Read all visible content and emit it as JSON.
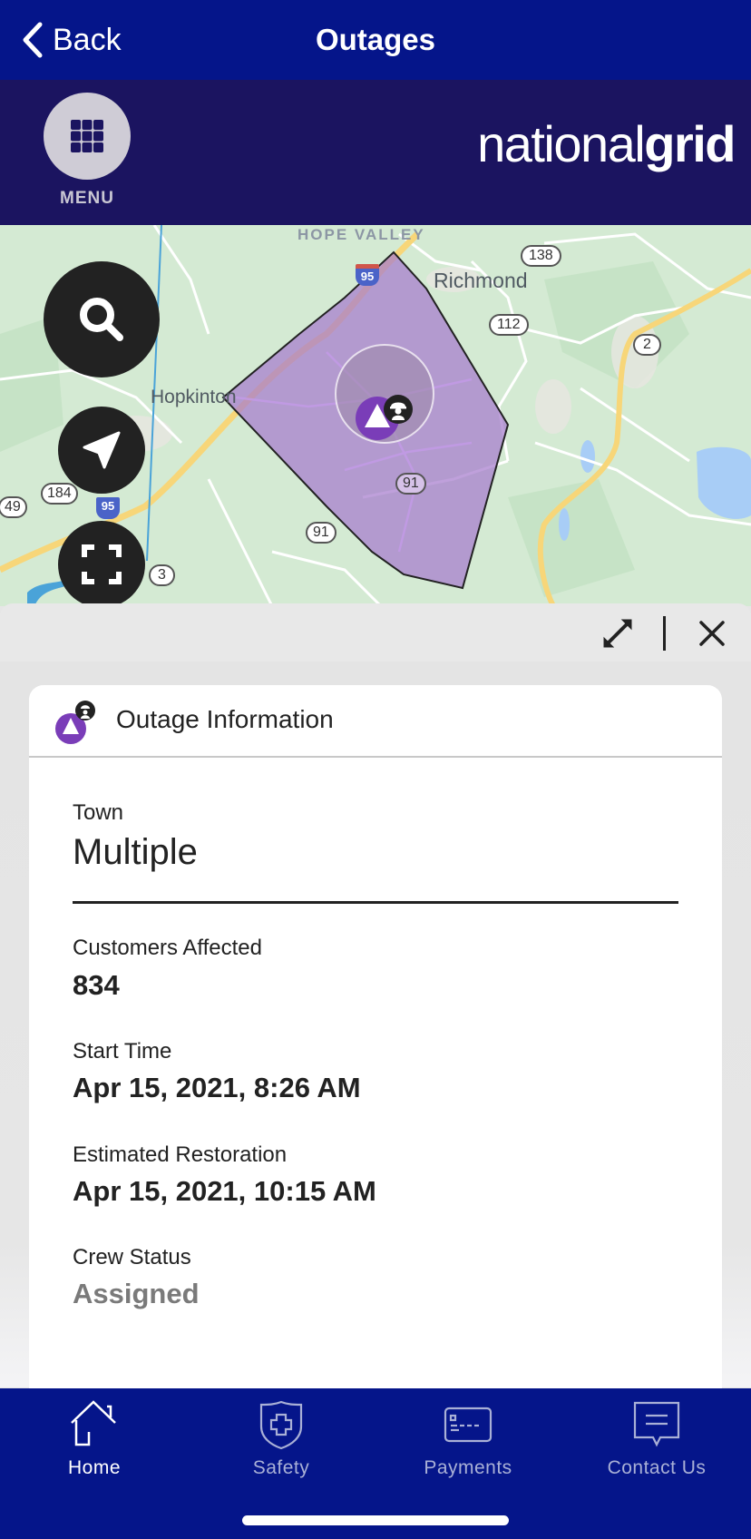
{
  "header": {
    "back_label": "Back",
    "title": "Outages"
  },
  "brand": {
    "menu_label": "MENU",
    "logo_light": "national",
    "logo_bold": "grid"
  },
  "map": {
    "labels": {
      "hope_valley": "HOPE VALLEY",
      "richmond": "Richmond",
      "hopkinton": "Hopkinton"
    },
    "shields": [
      "138",
      "112",
      "2",
      "91",
      "91",
      "184",
      "49",
      "3"
    ],
    "interstate": "95",
    "outage_color": "#7a3db8",
    "controls": [
      "search",
      "locate",
      "fullscreen"
    ]
  },
  "panel": {
    "card_title": "Outage Information",
    "town_label": "Town",
    "town_value": "Multiple",
    "customers_label": "Customers Affected",
    "customers_value": "834",
    "start_label": "Start Time",
    "start_value": "Apr 15, 2021, 8:26 AM",
    "restore_label": "Estimated Restoration",
    "restore_value": "Apr 15, 2021, 10:15 AM",
    "crew_label": "Crew Status",
    "crew_value": "Assigned"
  },
  "nav": {
    "items": [
      {
        "label": "Home",
        "icon": "home-icon",
        "active": true
      },
      {
        "label": "Safety",
        "icon": "shield-cross-icon",
        "active": false
      },
      {
        "label": "Payments",
        "icon": "card-icon",
        "active": false
      },
      {
        "label": "Contact Us",
        "icon": "chat-icon",
        "active": false
      }
    ]
  },
  "colors": {
    "topbar": "#05158a",
    "brandbar": "#1b1460",
    "outage_marker": "#7a3db8",
    "nav_inactive": "#a9b0d6"
  }
}
